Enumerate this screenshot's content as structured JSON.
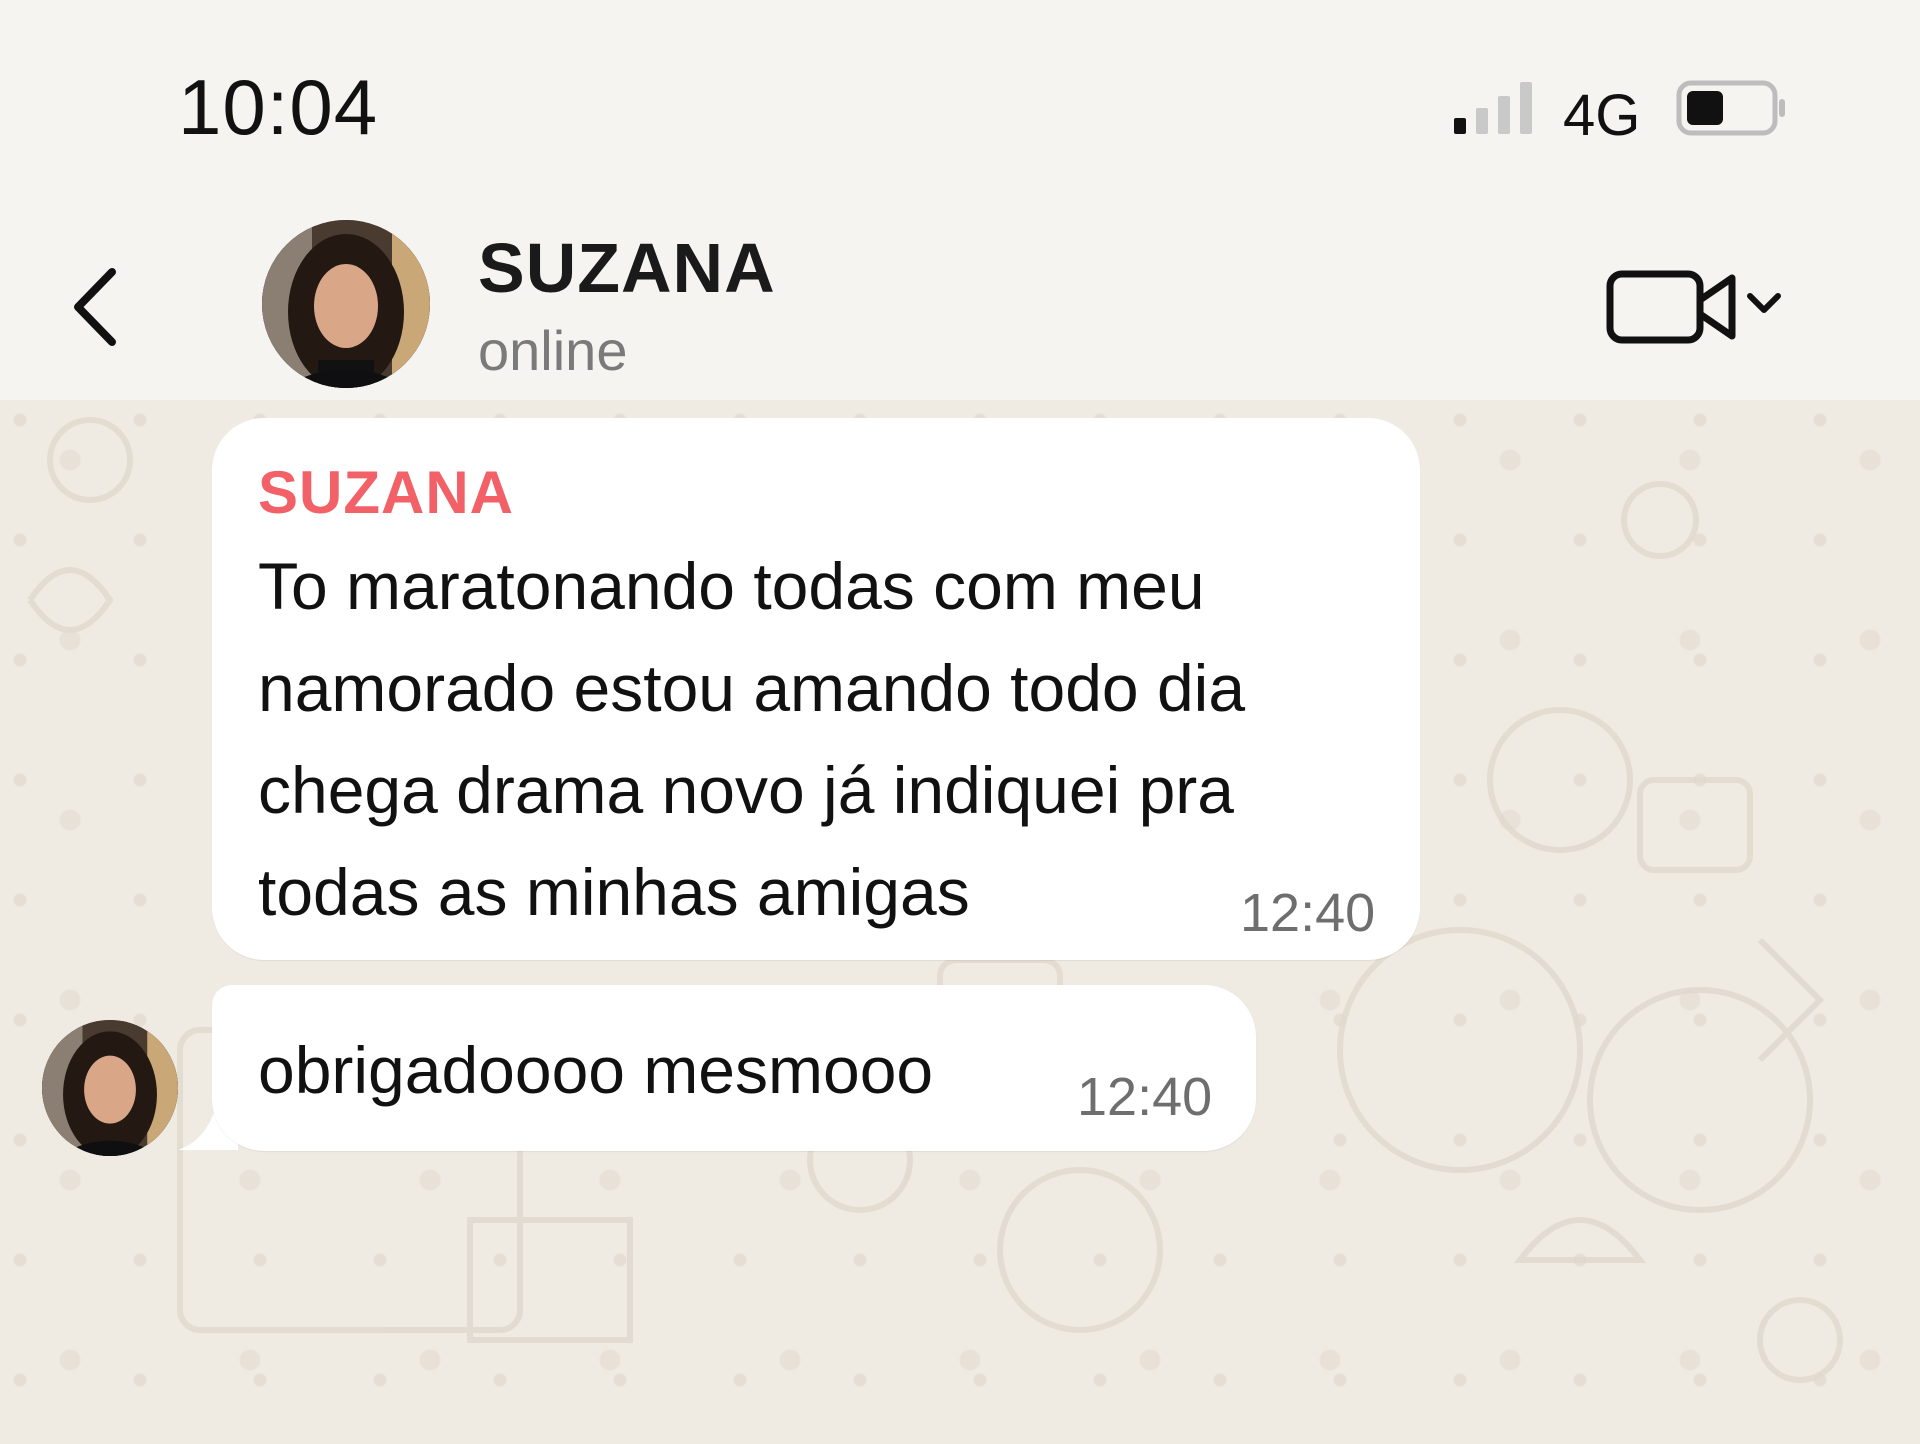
{
  "status_bar": {
    "time": "10:04",
    "network": "4G",
    "signal_bars_active": 1,
    "signal_bars_total": 4,
    "battery_level": 0.4
  },
  "header": {
    "contact_name": "SUZANA",
    "contact_status": "online",
    "icons": [
      "chevron-left-icon",
      "video-camera-icon",
      "chevron-down-icon"
    ]
  },
  "messages": [
    {
      "sender": "SUZANA",
      "lines": [
        "To maratonando todas com meu",
        "namorado estou amando todo dia",
        "chega drama novo já indiquei pra",
        "todas as minhas amigas"
      ],
      "time": "12:40"
    },
    {
      "text": "obrigadoooo mesmooo",
      "time": "12:40"
    }
  ],
  "colors": {
    "header_bg": "#f5f4f1",
    "chat_bg": "#efeae2",
    "bubble_bg": "#ffffff",
    "sender_name": "#f26168",
    "muted_text": "#7a7a7a"
  }
}
